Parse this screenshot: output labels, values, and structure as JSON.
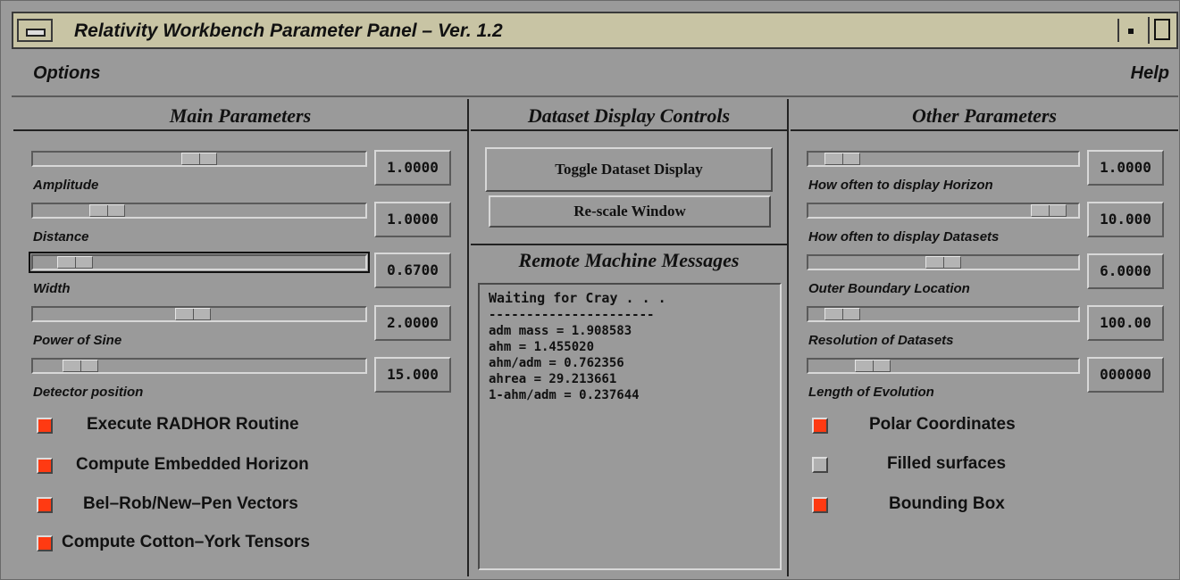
{
  "window": {
    "title": "Relativity Workbench Parameter Panel – Ver. 1.2"
  },
  "menu": {
    "options": "Options",
    "help": "Help"
  },
  "main": {
    "title": "Main Parameters",
    "sliders": [
      {
        "label": "Amplitude",
        "value": "1.0000",
        "position": 0.5
      },
      {
        "label": "Distance",
        "value": "1.0000",
        "position": 0.19
      },
      {
        "label": "Width",
        "value": "0.6700",
        "position": 0.08
      },
      {
        "label": "Power of Sine",
        "value": "2.0000",
        "position": 0.48
      },
      {
        "label": "Detector position",
        "value": "15.000",
        "position": 0.1
      }
    ],
    "checkboxes": [
      {
        "label": "Execute RADHOR Routine",
        "checked": true
      },
      {
        "label": "Compute Embedded Horizon",
        "checked": true
      },
      {
        "label": "Bel–Rob/New–Pen Vectors",
        "checked": true
      },
      {
        "label": "Compute Cotton–York Tensors",
        "checked": true
      }
    ]
  },
  "dataset": {
    "title": "Dataset Display Controls",
    "toggle_button": "Toggle Dataset Display",
    "rescale_button": "Re-scale Window"
  },
  "messages": {
    "title": "Remote Machine Messages",
    "first_line": "Waiting for Cray . . .",
    "separator": "----------------------",
    "lines": [
      "adm mass = 1.908583",
      "ahm = 1.455020",
      "ahm/adm = 0.762356",
      "ahrea = 29.213661",
      "1-ahm/adm = 0.237644"
    ]
  },
  "other": {
    "title": "Other Parameters",
    "sliders": [
      {
        "label": "How often to display Horizon",
        "value": "1.0000",
        "position": 0.07
      },
      {
        "label": "How often to display Datasets",
        "value": "10.000",
        "position": 0.95
      },
      {
        "label": "Outer Boundary Location",
        "value": "6.0000",
        "position": 0.5
      },
      {
        "label": "Resolution of Datasets",
        "value": "100.00",
        "position": 0.07
      },
      {
        "label": "Length of Evolution",
        "value": "000000",
        "position": 0.2
      }
    ],
    "checkboxes": [
      {
        "label": "Polar Coordinates",
        "checked": true
      },
      {
        "label": "Filled surfaces",
        "checked": false
      },
      {
        "label": "Bounding Box",
        "checked": true
      }
    ]
  },
  "colors": {
    "checked": "#ff3a12",
    "unchecked": "#b0b0b0",
    "background": "#9a9a9a"
  }
}
